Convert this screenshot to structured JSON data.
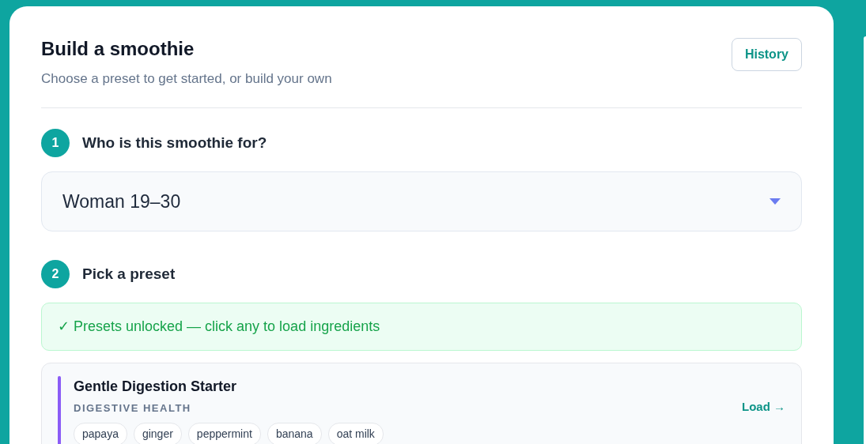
{
  "header": {
    "title": "Build a smoothie",
    "subtitle": "Choose a preset to get started, or build your own",
    "history_button": "History"
  },
  "steps": [
    {
      "number": "1",
      "title": "Who is this smoothie for?",
      "kind": "select",
      "value": "Woman 19–30"
    },
    {
      "number": "2",
      "title": "Pick a preset",
      "kind": "presets",
      "notice": "✓ Presets unlocked — click any to load ingredients",
      "presets": [
        {
          "name": "Gentle Digestion Starter",
          "category": "DIGESTIVE HEALTH",
          "color": "#8b5cf6",
          "action": "Load →",
          "ingredients": [
            "papaya",
            "ginger",
            "peppermint",
            "banana",
            "oat milk"
          ]
        }
      ]
    }
  ]
}
